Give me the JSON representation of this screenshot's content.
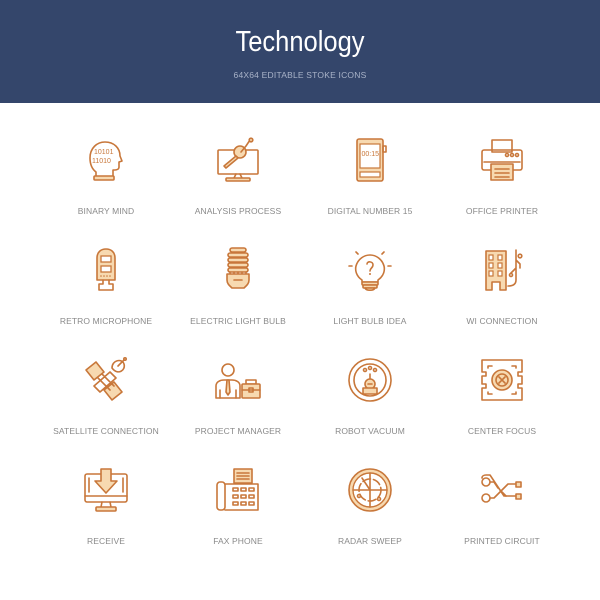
{
  "header": {
    "title": "Technology",
    "subtitle": "64X64 EDITABLE STOKE ICONS"
  },
  "colors": {
    "header_bg": "#34466b",
    "icon_stroke": "#c8773a",
    "icon_fill": "#f7d9b0",
    "label": "#8a8a8a"
  },
  "icons": [
    {
      "label": "BINARY MIND",
      "icon": "binary-mind-icon"
    },
    {
      "label": "ANALYSIS PROCESS",
      "icon": "analysis-process-icon"
    },
    {
      "label": "DIGITAL NUMBER 15",
      "icon": "digital-number-icon",
      "display": "00:15"
    },
    {
      "label": "OFFICE PRINTER",
      "icon": "office-printer-icon"
    },
    {
      "label": "RETRO MICROPHONE",
      "icon": "retro-microphone-icon"
    },
    {
      "label": "ELECTRIC LIGHT BULB",
      "icon": "electric-light-bulb-icon"
    },
    {
      "label": "LIGHT BULB IDEA",
      "icon": "light-bulb-idea-icon"
    },
    {
      "label": "WI CONNECTION",
      "icon": "wi-connection-icon"
    },
    {
      "label": "SATELLITE CONNECTION",
      "icon": "satellite-connection-icon"
    },
    {
      "label": "PROJECT MANAGER",
      "icon": "project-manager-icon"
    },
    {
      "label": "ROBOT VACUUM",
      "icon": "robot-vacuum-icon"
    },
    {
      "label": "CENTER FOCUS",
      "icon": "center-focus-icon"
    },
    {
      "label": "RECEIVE",
      "icon": "receive-icon"
    },
    {
      "label": "FAX PHONE",
      "icon": "fax-phone-icon"
    },
    {
      "label": "RADAR SWEEP",
      "icon": "radar-sweep-icon"
    },
    {
      "label": "PRINTED CIRCUIT",
      "icon": "printed-circuit-icon"
    }
  ]
}
